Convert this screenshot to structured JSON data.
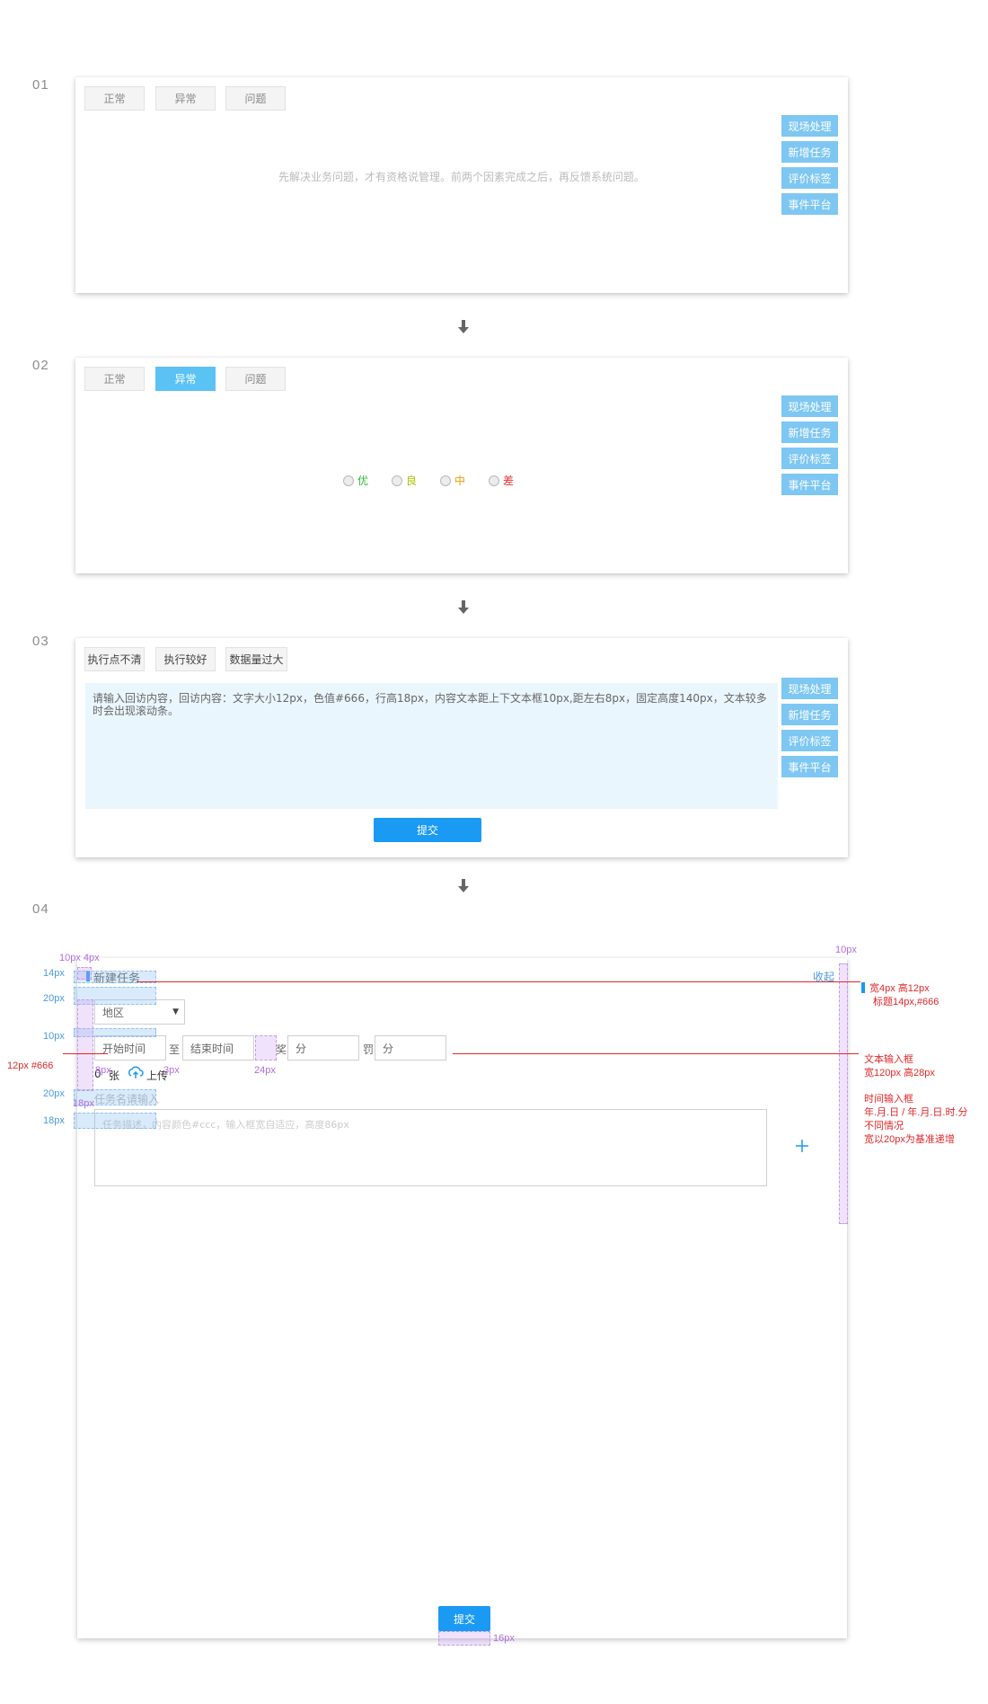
{
  "steps": [
    "01",
    "02",
    "03",
    "04"
  ],
  "side_buttons": [
    "现场处理",
    "新增任务",
    "评价标签",
    "事件平台"
  ],
  "panel1": {
    "tabs": [
      "正常",
      "异常",
      "问题"
    ],
    "hint": "先解决业务问题，才有资格说管理。前两个因素完成之后，再反馈系统问题。"
  },
  "panel2": {
    "tabs": [
      "正常",
      "异常",
      "问题"
    ],
    "active_tab": "异常",
    "ratings": [
      {
        "label": "优",
        "color": "#2dbd2d"
      },
      {
        "label": "良",
        "color": "#a5c400"
      },
      {
        "label": "中",
        "color": "#f29a00"
      },
      {
        "label": "差",
        "color": "#e53333"
      }
    ]
  },
  "panel3": {
    "tabs": [
      "执行点不清",
      "执行较好",
      "数据量过大"
    ],
    "textarea": "请输入回访内容，回访内容：文字大小12px，色值#666，行高18px，内容文本距上下文本框10px,距左右8px，固定高度140px，文本较多时会出现滚动条。",
    "submit": "提交"
  },
  "panel4": {
    "title": "新建任务",
    "collapse": "收起",
    "region_select": "地区",
    "start_time": "开始时间",
    "to": "至",
    "end_time": "结束时间",
    "reward_label": "奖",
    "reward_placeholder": "分",
    "penalty_label": "罚",
    "penalty_placeholder": "分",
    "count": "0",
    "count_unit": "张",
    "upload": "上传",
    "task_name_placeholder": "任务名请输入",
    "task_desc_placeholder": "任务描述，内容颜色#ccc，输入框宽自适应，高度86px",
    "submit": "提交"
  },
  "annotations": {
    "top_left": "10px 4px",
    "a14": "14px",
    "a20a": "20px",
    "a10": "10px",
    "left_red": "12px #666",
    "a8": "8px",
    "a3": "3px",
    "a24": "24px",
    "a20b": "20px",
    "a18a": "18px",
    "a18b": "18px",
    "right10": "10px",
    "bottom16": "16px",
    "right_title_1": "宽4px  高12px",
    "right_title_2": "标题14px,#666",
    "right_input_1": "文本输入框",
    "right_input_2": "宽120px  高28px",
    "right_time_1": "时间输入框",
    "right_time_2": "年.月.日 / 年.月.日.时.分",
    "right_time_3": "不同情况",
    "right_time_4": "宽以20px为基准递增"
  },
  "colors": {
    "accent": "#1a9af2",
    "side_button": "#7ec7f2",
    "active_tab": "#5bc2f4",
    "annotation_red": "#e0282a",
    "annotation_blue": "#4a9ae0",
    "annotation_purple": "#b06de0"
  }
}
